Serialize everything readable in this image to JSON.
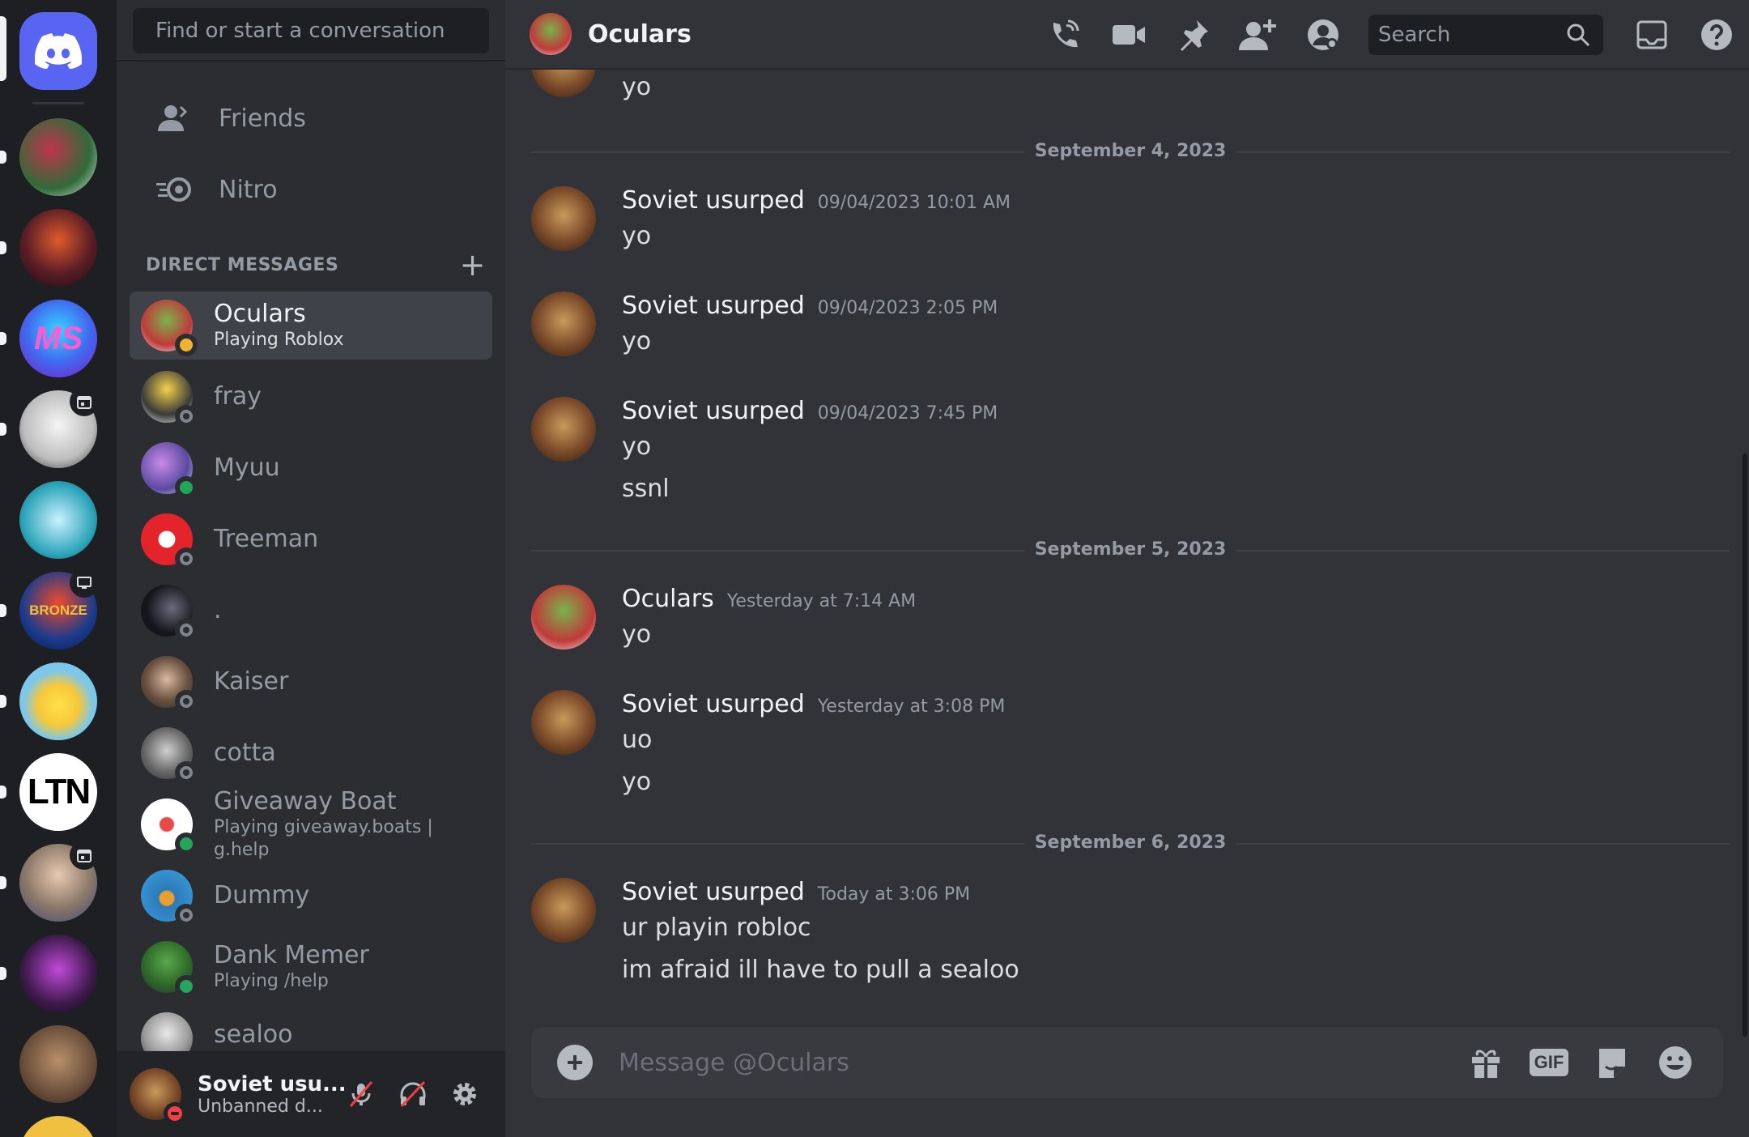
{
  "sidebar": {
    "search_placeholder": "Find or start a conversation",
    "nav": {
      "friends": "Friends",
      "nitro": "Nitro"
    },
    "dm_header": "DIRECT MESSAGES",
    "dms": [
      {
        "name": "Oculars",
        "sub": "Playing Roblox",
        "status": "idle"
      },
      {
        "name": "fray",
        "sub": "",
        "status": "offline"
      },
      {
        "name": "Myuu",
        "sub": "",
        "status": "online"
      },
      {
        "name": "Treeman",
        "sub": "",
        "status": "offline"
      },
      {
        "name": ".",
        "sub": "",
        "status": "offline"
      },
      {
        "name": "Kaiser",
        "sub": "",
        "status": "offline"
      },
      {
        "name": "cotta",
        "sub": "",
        "status": "offline"
      },
      {
        "name": "Giveaway Boat",
        "sub": "Playing giveaway.boats | g.help",
        "status": "online"
      },
      {
        "name": "Dummy",
        "sub": "",
        "status": "offline"
      },
      {
        "name": "Dank Memer",
        "sub": "Playing /help",
        "status": "online"
      },
      {
        "name": "sealoo",
        "sub": "",
        "status": "offline"
      }
    ],
    "user": {
      "name": "Soviet usu...",
      "status": "Unbanned d..."
    }
  },
  "servers": [
    {
      "label": "",
      "color": "#2f6b3a"
    },
    {
      "label": "",
      "color": "#5a1e26"
    },
    {
      "label": "MS",
      "color": "#3f6df0"
    },
    {
      "label": "",
      "color": "#d9d9d9"
    },
    {
      "label": "",
      "color": "#2aa3b8"
    },
    {
      "label": "BRONZE",
      "color": "#1b3b8c"
    },
    {
      "label": "",
      "color": "#7cc7ea"
    },
    {
      "label": "LTN",
      "color": "#ffffff"
    },
    {
      "label": "",
      "color": "#8a7768"
    },
    {
      "label": "",
      "color": "#3c1a4a"
    },
    {
      "label": "",
      "color": "#6a4e3a"
    }
  ],
  "chat": {
    "title": "Oculars",
    "search_placeholder": "Search",
    "composer_placeholder": "Message @Oculars",
    "gif_label": "GIF",
    "top_partial_text": "yo",
    "dividers": [
      "September 4, 2023",
      "September 5, 2023",
      "September 6, 2023"
    ],
    "messages": [
      {
        "author": "Soviet usurped",
        "time": "09/04/2023 10:01 AM",
        "lines": [
          "yo"
        ]
      },
      {
        "author": "Soviet usurped",
        "time": "09/04/2023 2:05 PM",
        "lines": [
          "yo"
        ]
      },
      {
        "author": "Soviet usurped",
        "time": "09/04/2023 7:45 PM",
        "lines": [
          "yo",
          "ssnl"
        ]
      },
      {
        "author": "Oculars",
        "time": "Yesterday at 7:14 AM",
        "lines": [
          "yo"
        ]
      },
      {
        "author": "Soviet usurped",
        "time": "Yesterday at 3:08 PM",
        "lines": [
          "uo",
          "yo"
        ]
      },
      {
        "author": "Soviet usurped",
        "time": "Today at 3:06 PM",
        "lines": [
          "ur playin robloc",
          "im afraid ill have to pull a sealoo"
        ]
      }
    ]
  },
  "colors": {
    "blurple": "#5865f2",
    "online": "#23a55a",
    "idle": "#f0b232",
    "dnd": "#f23f43"
  }
}
